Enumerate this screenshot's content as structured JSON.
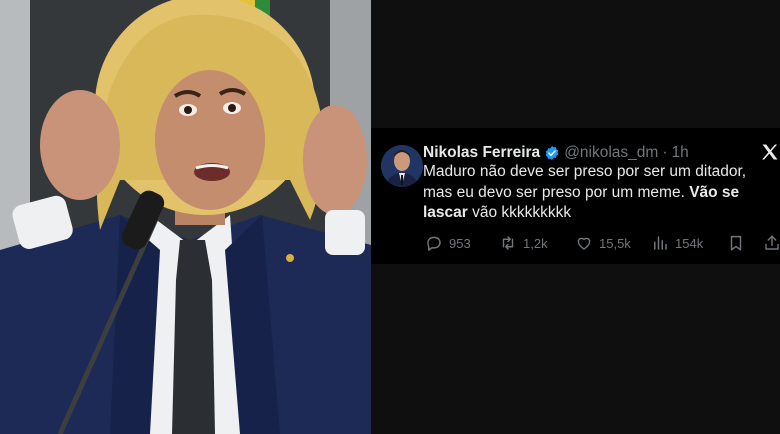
{
  "tweet": {
    "author_name": "Nikolas Ferreira",
    "handle": "@nikolas_dm",
    "separator": "·",
    "time": "1h",
    "text_line1": "Maduro não deve ser preso por ser um ditador,",
    "text_line2_regular": "mas eu devo ser preso por um meme. ",
    "text_line2_bold": "Vão se",
    "text_line3_bold": "lascar",
    "text_line3_regular": " vão kkkkkkkkk",
    "replies": "953",
    "retweets": "1,2k",
    "likes": "15,5k",
    "views": "154k"
  },
  "icons": {
    "verified": "verified-badge-icon",
    "platform": "x-logo-icon",
    "reply": "reply-icon",
    "retweet": "retweet-icon",
    "like": "heart-icon",
    "views": "views-icon",
    "bookmark": "bookmark-icon",
    "share": "share-icon"
  },
  "colors": {
    "background": "#0f0f10",
    "tweet_bg": "#000000",
    "text_primary": "#e7e9ea",
    "text_secondary": "#71767b",
    "verified_blue": "#1d9bf0"
  }
}
